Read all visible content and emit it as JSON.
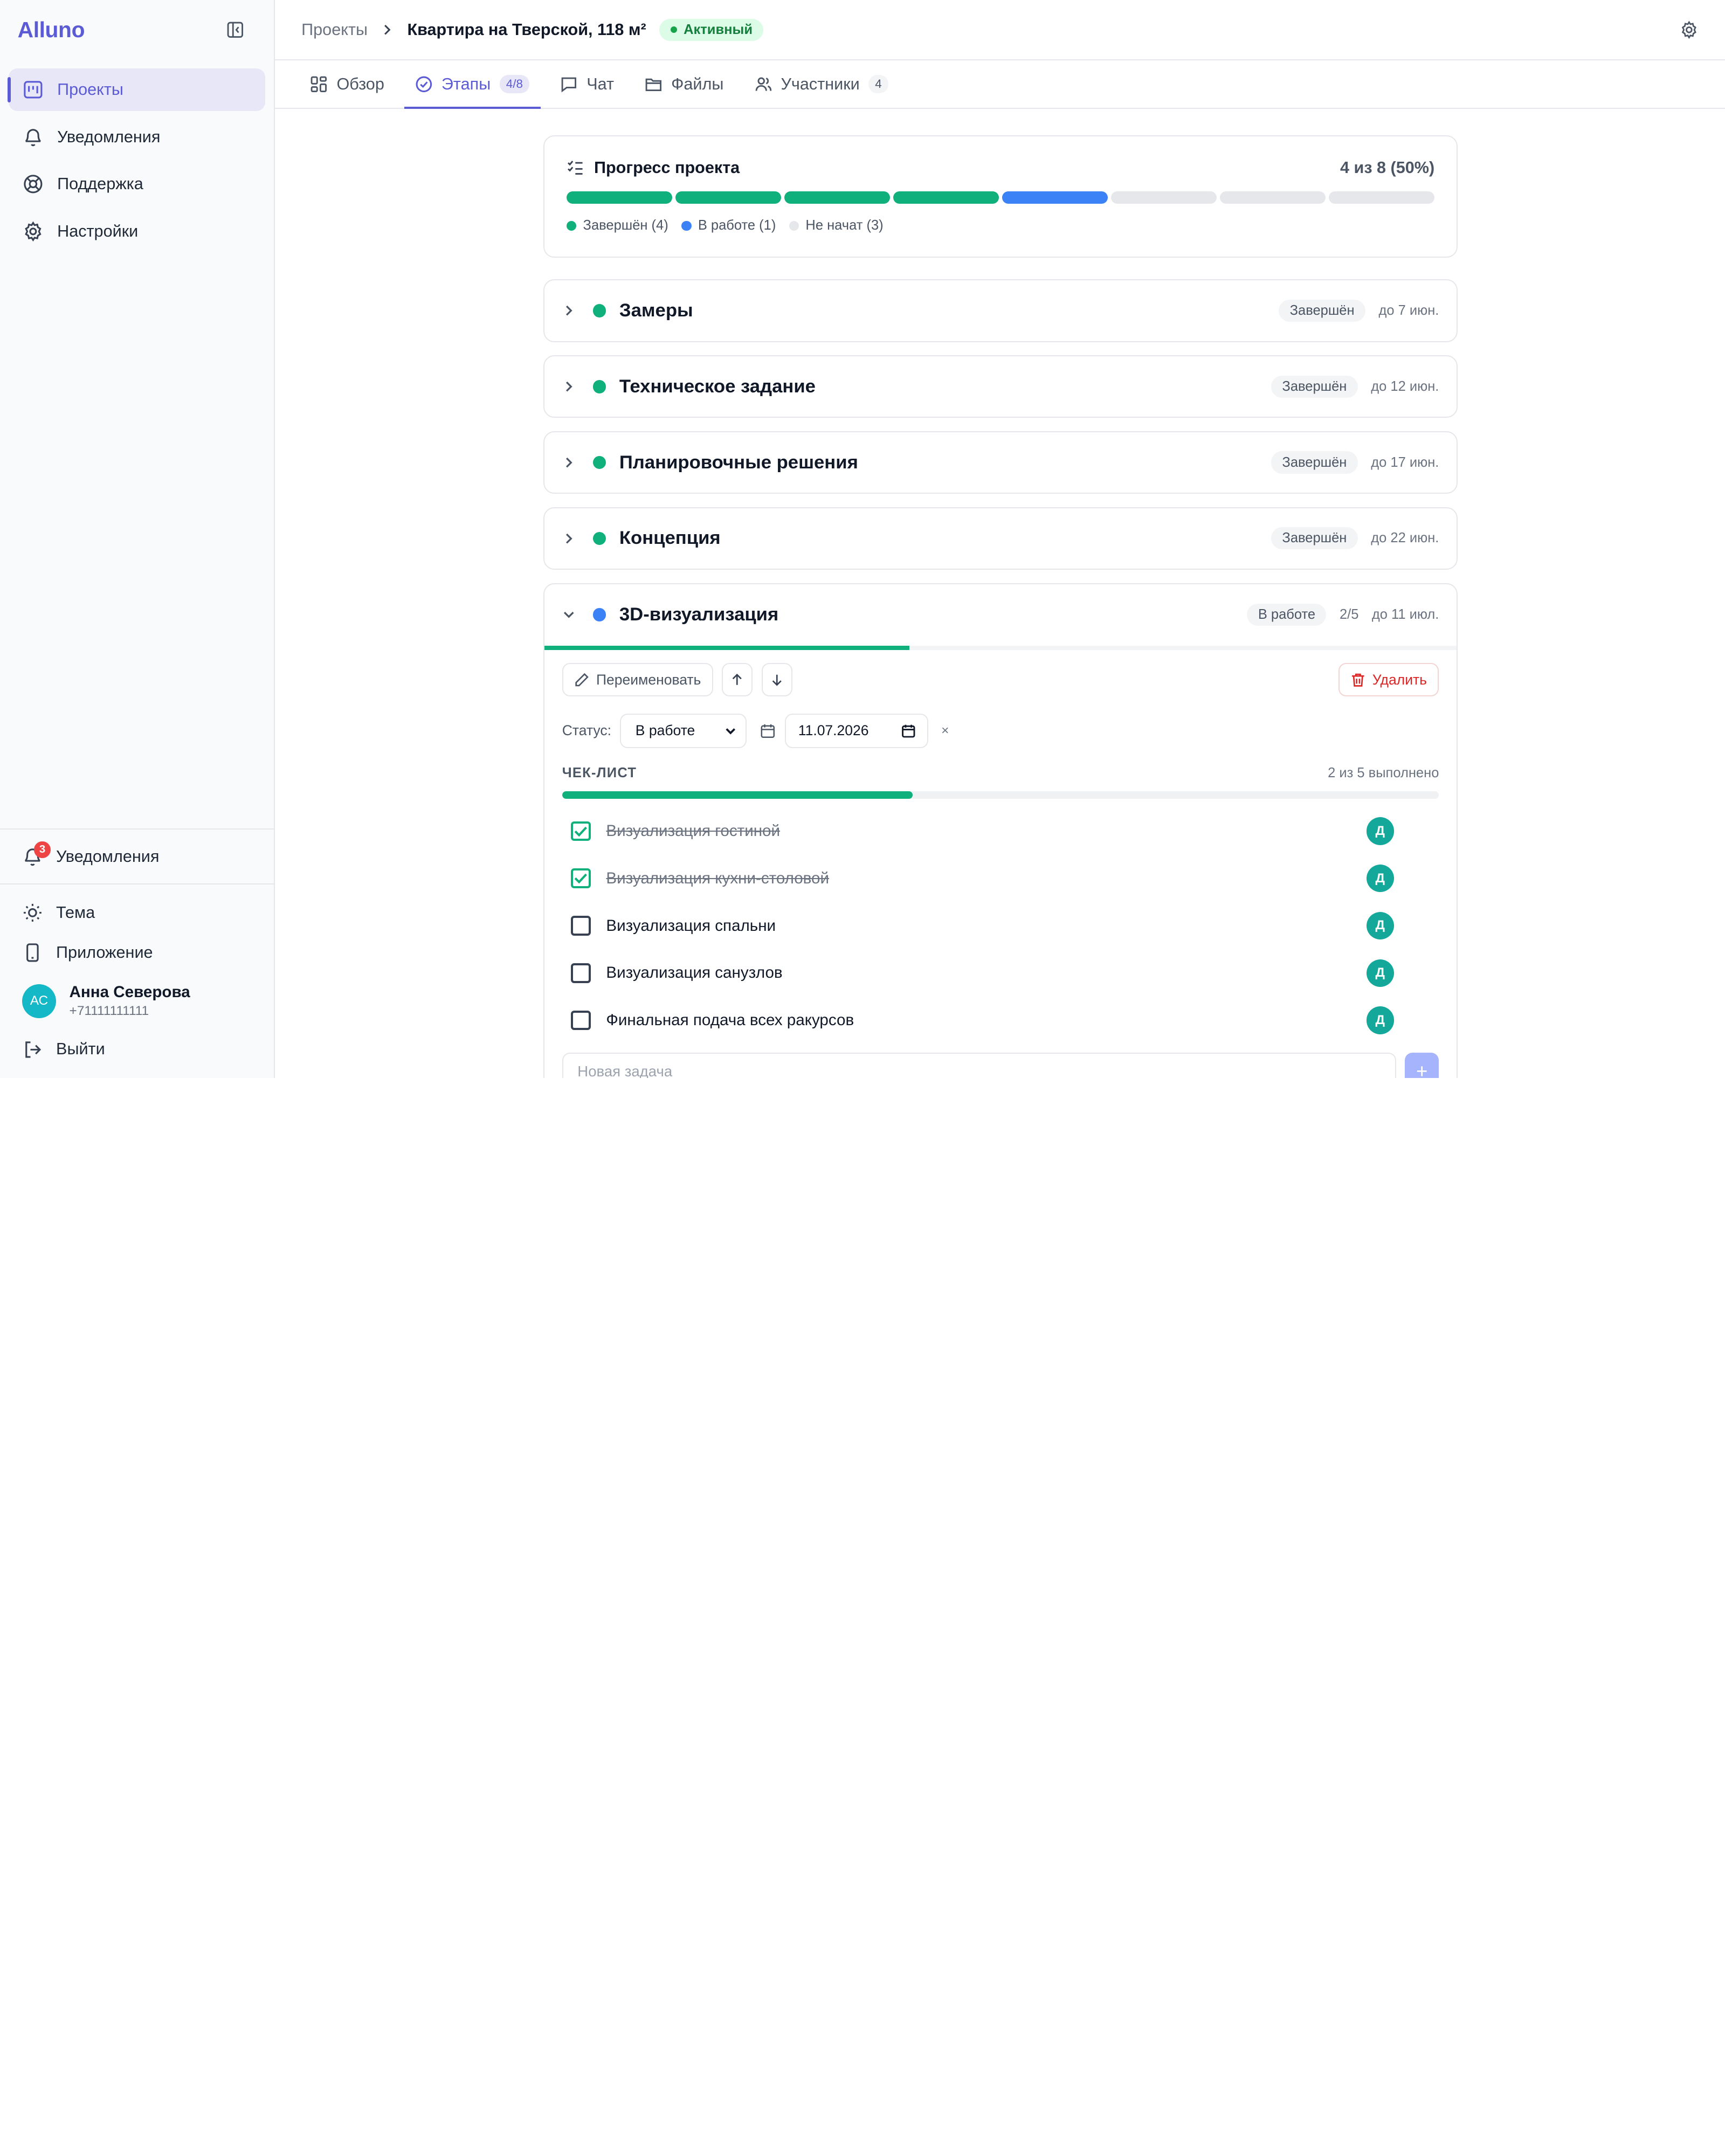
{
  "app": {
    "brand": "Alluno"
  },
  "sidebar": {
    "nav": [
      {
        "label": "Проекты",
        "icon": "kanban-icon",
        "active": true
      },
      {
        "label": "Уведомления",
        "icon": "bell-icon"
      },
      {
        "label": "Поддержка",
        "icon": "lifebuoy-icon"
      },
      {
        "label": "Настройки",
        "icon": "gear-icon"
      }
    ],
    "notifications": {
      "label": "Уведомления",
      "badge": "3"
    },
    "theme_label": "Тема",
    "app_label": "Приложение",
    "user": {
      "initials": "АС",
      "name": "Анна Северова",
      "phone": "+71111111111"
    },
    "logout_label": "Выйти"
  },
  "header": {
    "breadcrumb_root": "Проекты",
    "project_title": "Квартира на Тверской, 118 м²",
    "status": "Активный"
  },
  "tabs": [
    {
      "label": "Обзор",
      "icon": "grid-icon"
    },
    {
      "label": "Этапы",
      "icon": "check-circle-icon",
      "count": "4/8",
      "active": true
    },
    {
      "label": "Чат",
      "icon": "chat-icon"
    },
    {
      "label": "Файлы",
      "icon": "folder-icon"
    },
    {
      "label": "Участники",
      "icon": "users-icon",
      "count": "4"
    }
  ],
  "progress": {
    "title": "Прогресс проекта",
    "count": "4 из 8 (50%)",
    "segments": [
      "done",
      "done",
      "done",
      "done",
      "work",
      "todo",
      "todo",
      "todo"
    ],
    "legend": {
      "done": "Завершён (4)",
      "work": "В работе (1)",
      "todo": "Не начат (3)"
    },
    "colors": {
      "done": "#10b07c",
      "work": "#3b82f6",
      "todo": "#e5e7eb"
    }
  },
  "stages": [
    {
      "name": "Замеры",
      "status": "Завершён",
      "due": "до 7 июн."
    },
    {
      "name": "Техническое задание",
      "status": "Завершён",
      "due": "до 12 июн."
    },
    {
      "name": "Планировочные решения",
      "status": "Завершён",
      "due": "до 17 июн."
    },
    {
      "name": "Концепция",
      "status": "Завершён",
      "due": "до 22 июн."
    }
  ],
  "open_stage": {
    "name": "3D-визуализация",
    "status": "В работе",
    "fraction": "2/5",
    "due": "до 11 июл.",
    "progress": 0.4,
    "rename_label": "Переименовать",
    "delete_label": "Удалить",
    "status_label": "Статус:",
    "status_value": "В работе",
    "date_value": "11.07.2026",
    "clear_label": "×",
    "checklist_title": "ЧЕК-ЛИСТ",
    "checklist_count": "2 из 5 выполнено",
    "checklist_progress": 0.4,
    "tasks": [
      {
        "text": "Визуализация гостиной",
        "done": true,
        "assignee": "Д"
      },
      {
        "text": "Визуализация кухни-столовой",
        "done": true,
        "assignee": "Д"
      },
      {
        "text": "Визуализация спальни",
        "done": false,
        "assignee": "Д"
      },
      {
        "text": "Визуализация санузлов",
        "done": false,
        "assignee": "Д"
      },
      {
        "text": "Финальная подача всех ракурсов",
        "done": false,
        "assignee": "Д"
      }
    ],
    "new_task_placeholder": "Новая задача",
    "add_label": "+"
  }
}
